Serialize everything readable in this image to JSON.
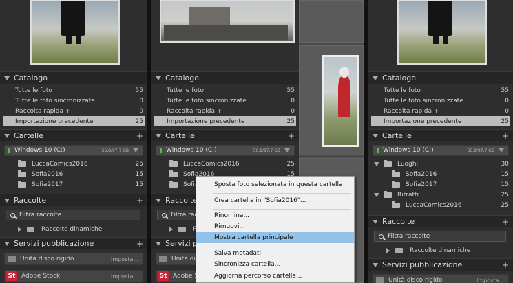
{
  "catalog": {
    "header": "Catalogo",
    "items": [
      {
        "label": "Tutte le foto",
        "count": "55"
      },
      {
        "label": "Tutte le foto sincronizzate",
        "count": "0"
      },
      {
        "label": "Raccolta rapida +",
        "count": "0"
      },
      {
        "label": "Importazione precedente",
        "count": "25"
      }
    ]
  },
  "folders": {
    "header": "Cartelle",
    "plus": "+",
    "volume_name": "Windows 10 (C:)",
    "volume_size": "56,8/97,7 GB",
    "flat_items": [
      {
        "label": "LuccaComics2016",
        "count": "25"
      },
      {
        "label": "Sofia2016",
        "count": "15"
      },
      {
        "label": "Sofia2017",
        "count": "15"
      }
    ],
    "tree_items": [
      {
        "label": "Luoghi",
        "count": "30"
      },
      {
        "label": "Sofia2016",
        "count": "15"
      },
      {
        "label": "Sofia2017",
        "count": "15"
      },
      {
        "label": "Ritratti",
        "count": "25"
      },
      {
        "label": "LuccaComics2016",
        "count": "25"
      }
    ]
  },
  "collections": {
    "header": "Raccolte",
    "plus": "+",
    "filter": "Filtra raccolte",
    "smart": "Raccolte dinamiche"
  },
  "publish": {
    "header": "Servizi pubblicazione",
    "plus": "+",
    "services": [
      {
        "label": "Unità disco rigido",
        "tag": "Imposta..."
      },
      {
        "label": "Adobe Stock",
        "tag": "Imposta...",
        "badge": "St"
      }
    ]
  },
  "context_menu": {
    "items": [
      "Sposta foto selezionata in questa cartella",
      "Crea cartella in \"Sofia2016\"...",
      "Rinomina...",
      "Rimuovi...",
      "Mostra cartella principale",
      "Salva metadati",
      "Sincronizza cartella...",
      "Aggiorna percorso cartella..."
    ],
    "hover_index": 4
  },
  "colors": {
    "panel_bg": "#2e2e2e",
    "selected_row": "#bdbdbd",
    "menu_hover": "#92c1ea",
    "volume_led": "#5fb35a",
    "stock_badge": "#cc2336"
  }
}
